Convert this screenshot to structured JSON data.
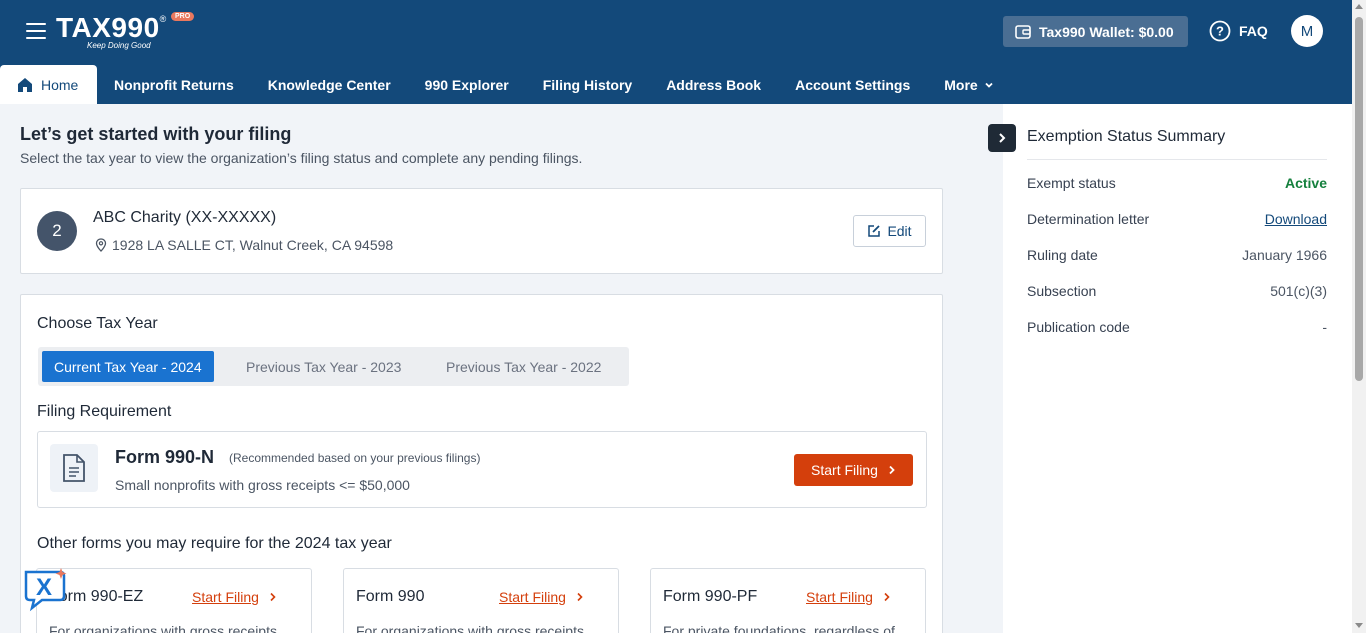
{
  "header": {
    "logo_text": "TAX990",
    "logo_reg": "®",
    "logo_badge": "PRO",
    "logo_tagline": "Keep Doing Good",
    "wallet_label": "Tax990 Wallet: $0.00",
    "faq_label": "FAQ",
    "avatar_initial": "M"
  },
  "nav": {
    "tabs": [
      {
        "label": "Home",
        "icon": "home-icon",
        "active": true
      },
      {
        "label": "Nonprofit Returns"
      },
      {
        "label": "Knowledge Center"
      },
      {
        "label": "990 Explorer"
      },
      {
        "label": "Filing History"
      },
      {
        "label": "Address Book"
      },
      {
        "label": "Account Settings"
      },
      {
        "label": "More",
        "icon": "chevron-down-icon"
      }
    ]
  },
  "main": {
    "title": "Let’s get started with your filing",
    "subtitle": "Select the tax year to view the organization’s filing status and complete any pending filings.",
    "org": {
      "badge": "2",
      "name": "ABC Charity (XX-XXXXX)",
      "address": "1928 LA SALLE CT, Walnut Creek, CA 94598",
      "edit_label": "Edit"
    },
    "tax_year": {
      "heading": "Choose Tax Year",
      "tabs": [
        {
          "label": "Current Tax Year - 2024",
          "active": true
        },
        {
          "label": "Previous Tax Year - 2023"
        },
        {
          "label": "Previous Tax Year - 2022"
        }
      ]
    },
    "filing_requirement": {
      "heading": "Filing Requirement",
      "form_name": "Form 990-N",
      "note": "(Recommended based on your previous filings)",
      "description": "Small nonprofits with gross receipts <= $50,000",
      "button_label": "Start Filing"
    },
    "other_forms": {
      "heading": "Other forms you may require for the 2024 tax year",
      "items": [
        {
          "name": "Form 990-EZ",
          "link": "Start Filing",
          "description": "For organizations with gross receipts"
        },
        {
          "name": "Form 990",
          "link": "Start Filing",
          "description": "For organizations with gross receipts"
        },
        {
          "name": "Form 990-PF",
          "link": "Start Filing",
          "description": "For private foundations, regardless of"
        }
      ]
    }
  },
  "side_panel": {
    "title": "Exemption Status Summary",
    "rows": [
      {
        "label": "Exempt status",
        "value": "Active"
      },
      {
        "label": "Determination letter",
        "value": "Download"
      },
      {
        "label": "Ruling date",
        "value": "January 1966"
      },
      {
        "label": "Subsection",
        "value": "501(c)(3)"
      },
      {
        "label": "Publication code",
        "value": "-"
      }
    ]
  },
  "colors": {
    "header_bg": "#13497a",
    "primary_action": "#d43f0c",
    "active_tab": "#1a73d0",
    "status_active": "#15803d"
  }
}
